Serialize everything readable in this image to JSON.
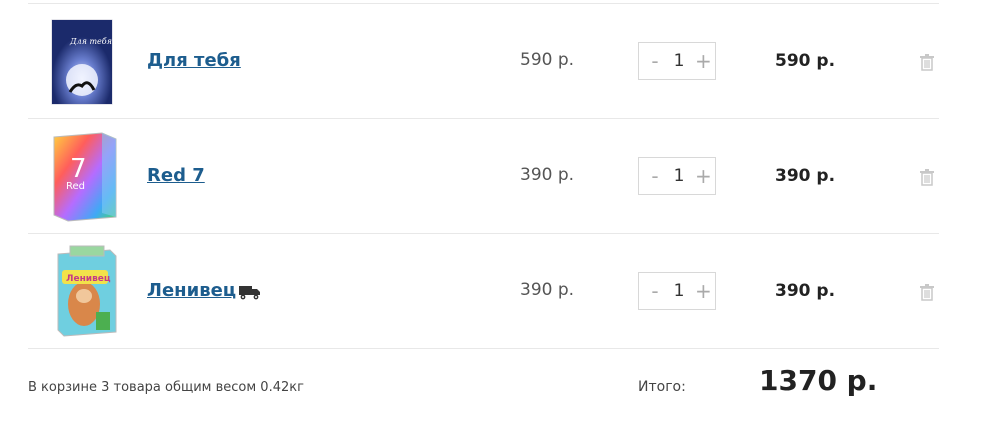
{
  "cart": {
    "items": [
      {
        "name": "Для тебя",
        "price": "590 р.",
        "qty": "1",
        "total": "590 р.",
        "image_icon": "product-box-night-icon"
      },
      {
        "name": "Red 7",
        "price": "390 р.",
        "qty": "1",
        "total": "390 р.",
        "image_icon": "product-box-rainbow-icon"
      },
      {
        "name": "Ленивец",
        "price": "390 р.",
        "qty": "1",
        "total": "390 р.",
        "image_icon": "product-box-sloth-icon",
        "delivery_icon": "truck-icon"
      }
    ],
    "qty_minus": "-",
    "qty_plus": "+"
  },
  "summary": {
    "description": "В корзине 3 товара общим весом 0.42кг",
    "total_label": "Итого:",
    "total_value": "1370 р."
  },
  "colors": {
    "link": "#1d5d8e",
    "border": "#e8e8e8",
    "muted": "#aaaaaa"
  }
}
